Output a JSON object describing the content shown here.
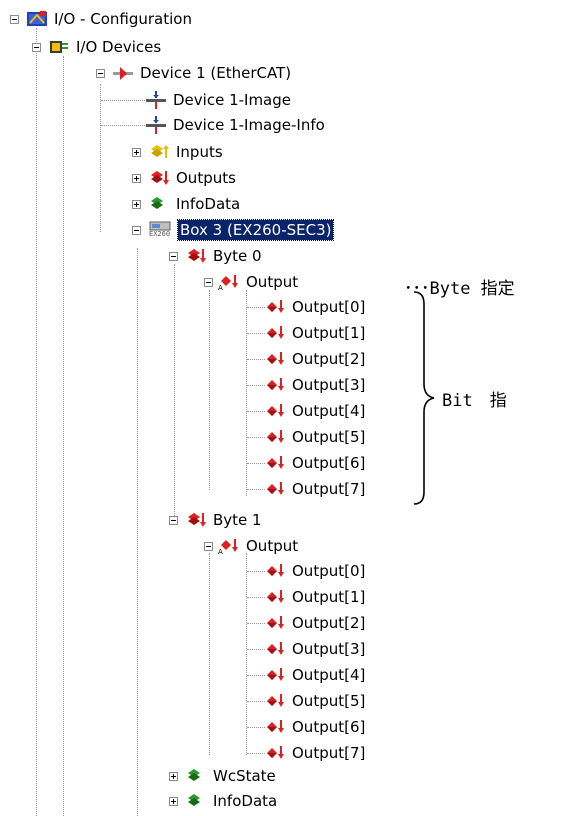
{
  "tree": {
    "root": "I/O - Configuration",
    "devices": "I/O Devices",
    "device1": "Device 1 (EtherCAT)",
    "image": "Device 1-Image",
    "image_info": "Device 1-Image-Info",
    "inputs": "Inputs",
    "outputs": "Outputs",
    "infodata": "InfoData",
    "box3": "Box 3 (EX260-SEC3)",
    "box_badge": "EX260",
    "byte0": "Byte 0",
    "byte1": "Byte 1",
    "output": "Output",
    "output_items": [
      "Output[0]",
      "Output[1]",
      "Output[2]",
      "Output[3]",
      "Output[4]",
      "Output[5]",
      "Output[6]",
      "Output[7]"
    ],
    "wcstate": "WcState",
    "infodata2": "InfoData"
  },
  "annotations": {
    "byte_note": "･･･Byte 指定",
    "bit_note": "Bit　指"
  },
  "colors": {
    "selection": "#0a246a",
    "tree_lines": "#9a9a9a",
    "output_icon_red": "#cc0000",
    "input_icon_yellow": "#e8c000",
    "info_icon_green": "#2a9a2a"
  }
}
